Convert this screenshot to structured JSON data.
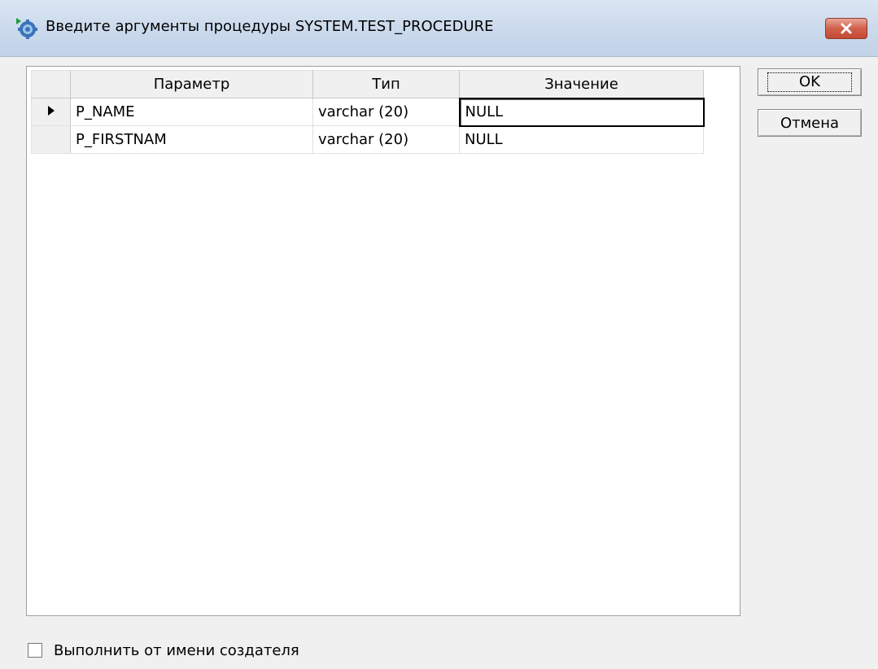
{
  "window": {
    "title": "Введите аргументы процедуры SYSTEM.TEST_PROCEDURE",
    "icon": "gear-globe-icon",
    "close_icon": "close-icon"
  },
  "grid": {
    "columns": [
      "Параметр",
      "Тип",
      "Значение"
    ],
    "rows": [
      {
        "parameter": "P_NAME",
        "type": "varchar (20)",
        "value": "NULL",
        "current": true
      },
      {
        "parameter": "P_FIRSTNAM",
        "type": "varchar (20)",
        "value": "NULL",
        "current": false
      }
    ]
  },
  "buttons": {
    "ok_label": "OK",
    "cancel_label": "Отмена"
  },
  "options": {
    "run_as_creator_label": "Выполнить от имени создателя",
    "run_as_creator_checked": false
  }
}
